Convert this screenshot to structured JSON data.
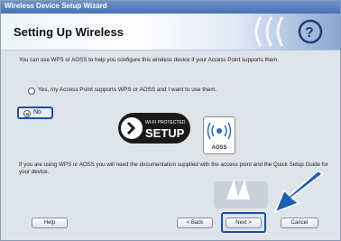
{
  "window": {
    "title": "Wireless Device Setup Wizard"
  },
  "header": {
    "title": "Setting Up Wireless"
  },
  "intro_text": "You can use WPS or AOSS to help you configure this wireless device if your Access Point supports them.",
  "options": {
    "yes_label": "Yes, my Access Point supports WPS or AOSS and I want to use them.",
    "no_label": "No"
  },
  "logos": {
    "wps_top": "WI-FI PROTECTED",
    "wps_main": "SETUP",
    "aoss": "AOSS"
  },
  "note_text": "If you are using WPS or AOSS you will need the documentation supplied with the access point and the Quick Setup Guide for your device.",
  "buttons": {
    "help": "Help",
    "back": "< Back",
    "next": "Next >",
    "cancel": "Cancel"
  },
  "colors": {
    "highlight": "#1c4fa3",
    "arrow": "#1d5fb0"
  }
}
